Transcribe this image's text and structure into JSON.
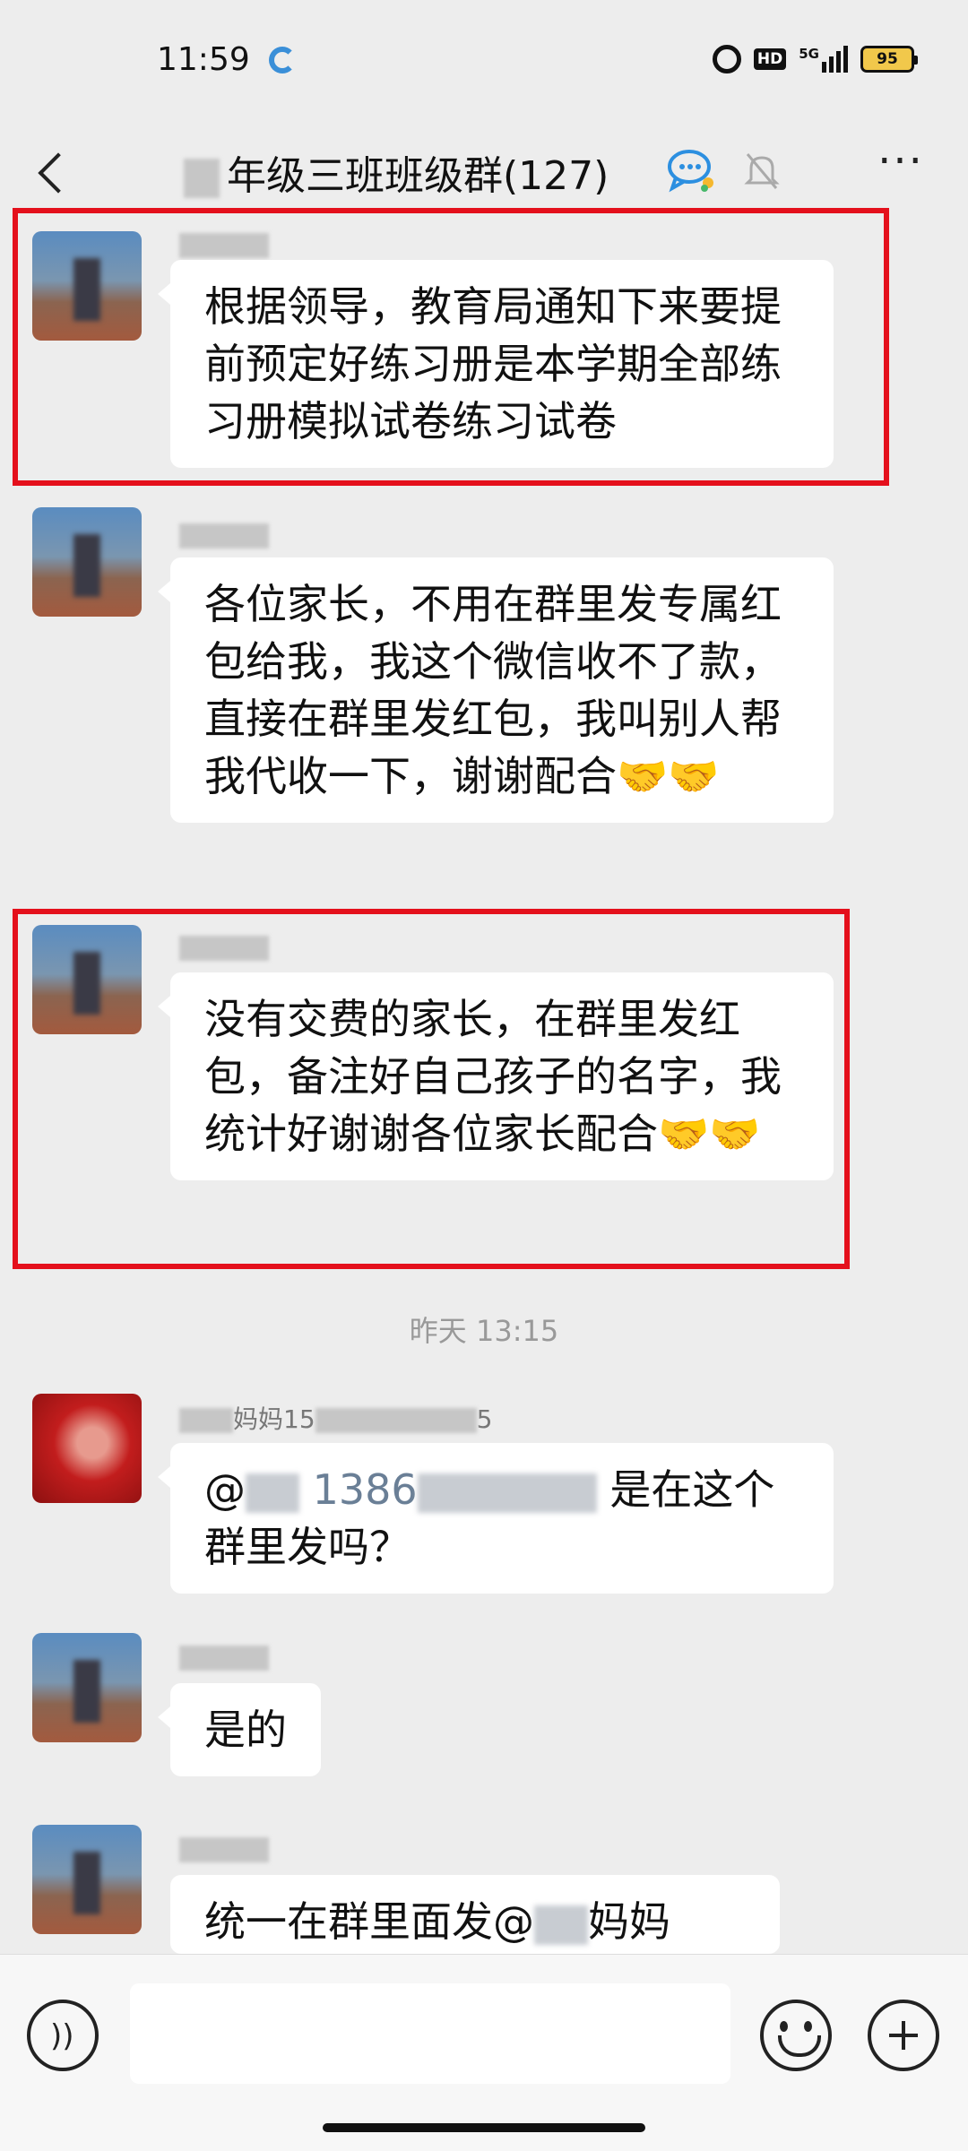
{
  "status_bar": {
    "time": "11:59",
    "hd": "HD",
    "network": "5G",
    "battery": "95"
  },
  "header": {
    "title": "年级三班班级群(127)"
  },
  "messages": [
    {
      "text": "根据领导，教育局通知下来要提前预定好练习册是本学期全部练习册模拟试卷练习试卷",
      "highlighted": true
    },
    {
      "text": "各位家长，不用在群里发专属红包给我，我这个微信收不了款，直接在群里发红包，我叫别人帮我代收一下，谢谢配合🤝🤝",
      "highlighted": false
    },
    {
      "text": "没有交费的家长，在群里发红包，备注好自己孩子的名字，我统计好谢谢各位家长配合🤝🤝",
      "highlighted": true
    },
    {
      "sender": "妈妈15",
      "sender_tail": "5",
      "mention_prefix": "@",
      "phone": "1386",
      "text_after": "是在这个群里发吗？"
    },
    {
      "text": "是的"
    },
    {
      "text_before": "统一在群里面发@",
      "text_after": "妈妈"
    }
  ],
  "timestamp": "昨天 13:15",
  "colors": {
    "highlight": "#e4101c",
    "background": "#ededed",
    "bubble": "#ffffff"
  },
  "icons": [
    "alarm-icon",
    "signal-icon",
    "battery-icon",
    "back-icon",
    "group-chat-icon",
    "mute-bell-icon",
    "more-icon",
    "voice-icon",
    "emoji-icon",
    "plus-icon"
  ]
}
